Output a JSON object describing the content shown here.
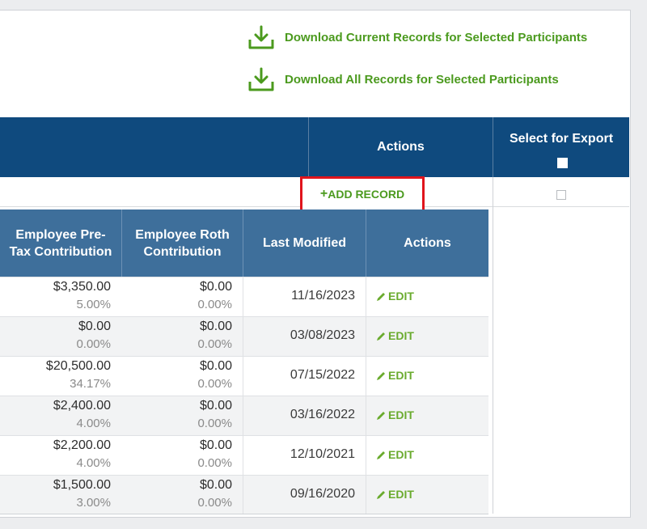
{
  "downloads": {
    "current_label": "Download Current Records for Selected Participants",
    "all_label": "Download All Records for Selected Participants",
    "icon": "download-icon"
  },
  "outer_table": {
    "actions_header": "Actions",
    "select_export_header": "Select for Export",
    "add_record_label": "ADD RECORD",
    "add_record_icon": "+"
  },
  "inner_table": {
    "headers": [
      "Employee Pre-Tax Contribution",
      "Employee Roth Contribution",
      "Last Modified",
      "Actions"
    ],
    "rows": [
      {
        "pretax": "$3,350.00",
        "pretax_pct": "5.00%",
        "roth": "$0.00",
        "roth_pct": "0.00%",
        "modified": "11/16/2023",
        "action": "EDIT"
      },
      {
        "pretax": "$0.00",
        "pretax_pct": "0.00%",
        "roth": "$0.00",
        "roth_pct": "0.00%",
        "modified": "03/08/2023",
        "action": "EDIT"
      },
      {
        "pretax": "$20,500.00",
        "pretax_pct": "34.17%",
        "roth": "$0.00",
        "roth_pct": "0.00%",
        "modified": "07/15/2022",
        "action": "EDIT"
      },
      {
        "pretax": "$2,400.00",
        "pretax_pct": "4.00%",
        "roth": "$0.00",
        "roth_pct": "0.00%",
        "modified": "03/16/2022",
        "action": "EDIT"
      },
      {
        "pretax": "$2,200.00",
        "pretax_pct": "4.00%",
        "roth": "$0.00",
        "roth_pct": "0.00%",
        "modified": "12/10/2021",
        "action": "EDIT"
      },
      {
        "pretax": "$1,500.00",
        "pretax_pct": "3.00%",
        "roth": "$0.00",
        "roth_pct": "0.00%",
        "modified": "09/16/2020",
        "action": "EDIT"
      }
    ]
  },
  "colors": {
    "header_dark": "#0f4a7e",
    "header_mid": "#3e6f9b",
    "accent_green": "#4b9a1e",
    "highlight_red": "#e0141c"
  }
}
